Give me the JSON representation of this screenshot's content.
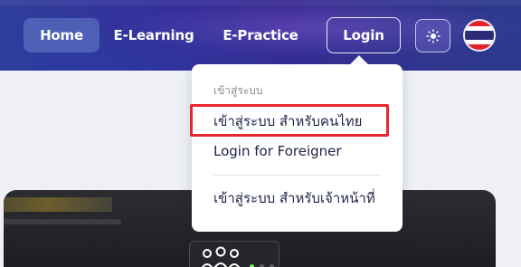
{
  "nav": {
    "home": "Home",
    "elearning": "E-Learning",
    "epractice": "E-Practice",
    "login": "Login",
    "theme_icon": "sun-icon",
    "language_icon": "thailand-flag-icon"
  },
  "dropdown": {
    "header": "เข้าสู่ระบบ",
    "items": [
      "เข้าสู่ระบบ สำหรับคนไทย",
      "Login for Foreigner",
      "เข้าสู่ระบบ สำหรับเจ้าหน้าที่"
    ]
  },
  "colors": {
    "nav_background": "#33338f",
    "highlight_border": "#e8262b",
    "dropdown_text": "#1d2447"
  }
}
